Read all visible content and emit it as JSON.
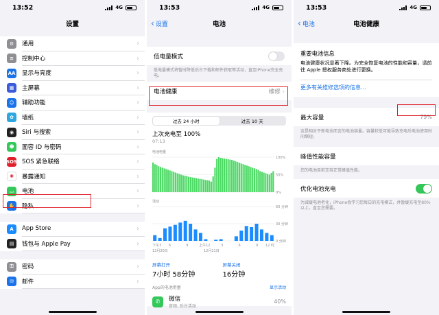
{
  "colors": {
    "accent": "#1a73e8",
    "green": "#34c759",
    "highlight": "#e0202a"
  },
  "panel1": {
    "time": "13:52",
    "network": "4G",
    "title": "设置",
    "items": [
      {
        "label": "通用",
        "icon": "gear-icon",
        "color": "#8e8e93",
        "glyph": "⚙"
      },
      {
        "label": "控制中心",
        "icon": "control-center-icon",
        "color": "#8e8e93",
        "glyph": "≡"
      },
      {
        "label": "显示与亮度",
        "icon": "display-icon",
        "color": "#1a73e8",
        "glyph": "AA"
      },
      {
        "label": "主屏幕",
        "icon": "home-screen-icon",
        "color": "#3b5bdb",
        "glyph": "▦"
      },
      {
        "label": "辅助功能",
        "icon": "accessibility-icon",
        "color": "#1a73e8",
        "glyph": "☺"
      },
      {
        "label": "墙纸",
        "icon": "wallpaper-icon",
        "color": "#2ea7e0",
        "glyph": "✿"
      },
      {
        "label": "Siri 与搜索",
        "icon": "siri-icon",
        "color": "#222222",
        "glyph": "◉"
      },
      {
        "label": "面容 ID 与密码",
        "icon": "face-id-icon",
        "color": "#34c759",
        "glyph": "☻"
      },
      {
        "label": "SOS 紧急联络",
        "icon": "sos-icon",
        "color": "#e0202a",
        "glyph": "SOS"
      },
      {
        "label": "暴露通知",
        "icon": "exposure-icon",
        "color": "#ffffff",
        "glyph": "✺"
      },
      {
        "label": "电池",
        "icon": "battery-icon",
        "color": "#34c759",
        "glyph": "▭"
      },
      {
        "label": "隐私",
        "icon": "privacy-icon",
        "color": "#1a73e8",
        "glyph": "✋"
      }
    ],
    "items2": [
      {
        "label": "App Store",
        "icon": "app-store-icon",
        "color": "#1a8cff",
        "glyph": "A"
      },
      {
        "label": "钱包与 Apple Pay",
        "icon": "wallet-icon",
        "color": "#222222",
        "glyph": "▤"
      }
    ],
    "items3": [
      {
        "label": "密码",
        "icon": "key-icon",
        "color": "#8e8e93",
        "glyph": "⚿"
      },
      {
        "label": "邮件",
        "icon": "mail-icon",
        "color": "#1a73e8",
        "glyph": "✉"
      }
    ]
  },
  "panel2": {
    "time": "13:53",
    "network": "4G",
    "back": "设置",
    "title": "电池",
    "low_power_label": "低电量模式",
    "low_power_desc": "低电量模式将暂时降低后台下载和邮件获取等活动，直至iPhone完全充电。",
    "health_label": "电池健康",
    "health_value": "维修",
    "seg_24h": "过去 24 小时",
    "seg_10d": "过去 10 天",
    "last_charge": "上次充电至 100%",
    "last_charge_time": "07:13",
    "level_label": "电池电量",
    "level_ticks": [
      "100%",
      "50%",
      "0%"
    ],
    "activity_label": "活动",
    "activity_ticks": [
      "60 分钟",
      "30 分钟",
      "0 分钟"
    ],
    "x_ticks": [
      "下午3",
      "6",
      "9",
      "上午12",
      "3",
      "6",
      "9",
      "12 时"
    ],
    "dates": [
      "12月20日",
      "12月21日"
    ],
    "screen_on_label": "屏幕打开",
    "screen_on_value": "7小时 58分钟",
    "screen_off_label": "屏幕关闭",
    "screen_off_value": "16分钟",
    "app_usage_label": "App的电池用量",
    "show_activity": "显示活动",
    "app_name": "微信",
    "app_detail": "音频, 后台活动",
    "app_percent": "40%"
  },
  "panel3": {
    "time": "13:53",
    "network": "4G",
    "back": "电池",
    "title": "电池健康",
    "notice_title": "重要电池信息",
    "notice_body": "电池健康状况显著下降。为完全恢复电池的性能和容量，请前往 Apple 授权服务商处进行更换。",
    "notice_link": "更多有关维修选项的信息…",
    "max_capacity_label": "最大容量",
    "max_capacity_value": "79%",
    "max_capacity_desc": "这是相对于新电池而言的电池容量。容量较低可能导致充电后电池使用时间缩短。",
    "peak_label": "峰值性能容量",
    "peak_desc": "您的电池目前支持正常峰值性能。",
    "optimized_label": "优化电池充电",
    "optimized_desc": "为减缓电池老化，iPhone会学习您每日的充电模式，并暂缓充电至80%以上，直至您需要。"
  },
  "chart_data": [
    {
      "type": "area",
      "title": "电池电量",
      "ylim": [
        0,
        100
      ],
      "y_ticks": [
        "100%",
        "50%",
        "0%"
      ],
      "values": [
        85,
        80,
        78,
        74,
        72,
        70,
        68,
        66,
        64,
        62,
        60,
        58,
        56,
        54,
        52,
        50,
        48,
        47,
        46,
        44,
        43,
        42,
        41,
        40,
        39,
        38,
        37,
        36,
        35,
        34,
        33,
        30,
        45,
        70,
        95,
        100,
        98,
        97,
        96,
        95,
        94,
        93,
        92,
        90,
        88,
        86,
        84,
        82,
        80,
        78,
        76,
        74,
        72,
        70,
        68,
        66,
        64,
        60,
        58,
        56,
        54,
        52,
        50,
        55,
        60
      ]
    },
    {
      "type": "bar",
      "title": "活动",
      "y_ticks": [
        "60 分钟",
        "30 分钟",
        "0 分钟"
      ],
      "categories": [
        "1",
        "2",
        "3",
        "4",
        "5",
        "6",
        "7",
        "8",
        "9",
        "10",
        "11",
        "12",
        "13",
        "14",
        "15",
        "16",
        "17",
        "18",
        "19",
        "20",
        "21",
        "22",
        "23",
        "24"
      ],
      "values": [
        10,
        5,
        22,
        25,
        28,
        32,
        35,
        30,
        20,
        14,
        3,
        0,
        2,
        3,
        0,
        0,
        8,
        18,
        26,
        24,
        30,
        20,
        14,
        10
      ]
    }
  ]
}
